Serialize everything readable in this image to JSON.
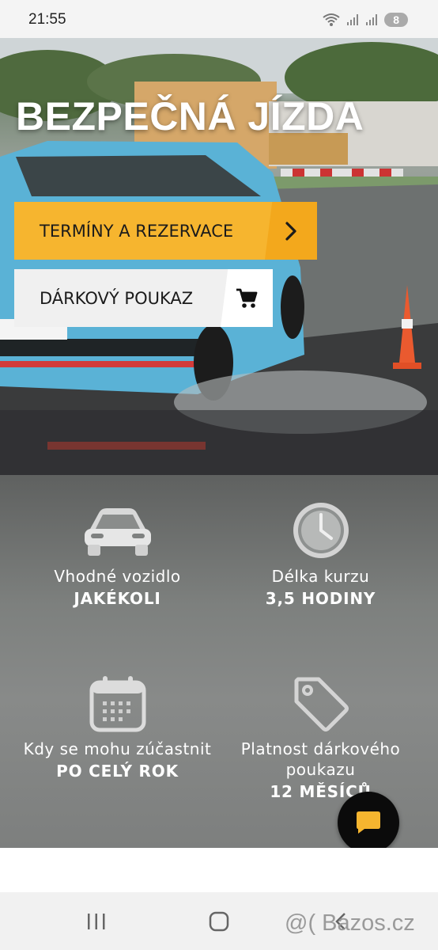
{
  "status_bar": {
    "time": "21:55",
    "notification_count": "8",
    "icons": [
      "wifi-icon",
      "signal-icon",
      "signal-icon",
      "add-icon"
    ]
  },
  "hero": {
    "title": "BEZPEČNÁ JÍZDA",
    "primary_button": {
      "label": "TERMÍNY A REZERVACE",
      "icon": "chevron-right-icon",
      "color": "#f6b52f"
    },
    "secondary_button": {
      "label": "DÁRKOVÝ POUKAZ",
      "icon": "cart-icon"
    }
  },
  "features": [
    {
      "icon": "car-icon",
      "title": "Vhodné vozidlo",
      "value": "JAKÉKOLI"
    },
    {
      "icon": "clock-icon",
      "title": "Délka kurzu",
      "value": "3,5 HODINY"
    },
    {
      "icon": "calendar-icon",
      "title": "Kdy se mohu zúčastnit",
      "value": "PO CELÝ ROK"
    },
    {
      "icon": "tag-icon",
      "title_line1": "Platnost dárkového",
      "title_line2": "poukazu",
      "value": "12 MĚSÍCŮ"
    }
  ],
  "chat": {
    "icon": "chat-icon",
    "color": "#f6b52f"
  },
  "nav": {
    "icons": [
      "recent-apps-icon",
      "home-icon",
      "back-icon"
    ]
  },
  "watermark": "@( Bazos.cz"
}
